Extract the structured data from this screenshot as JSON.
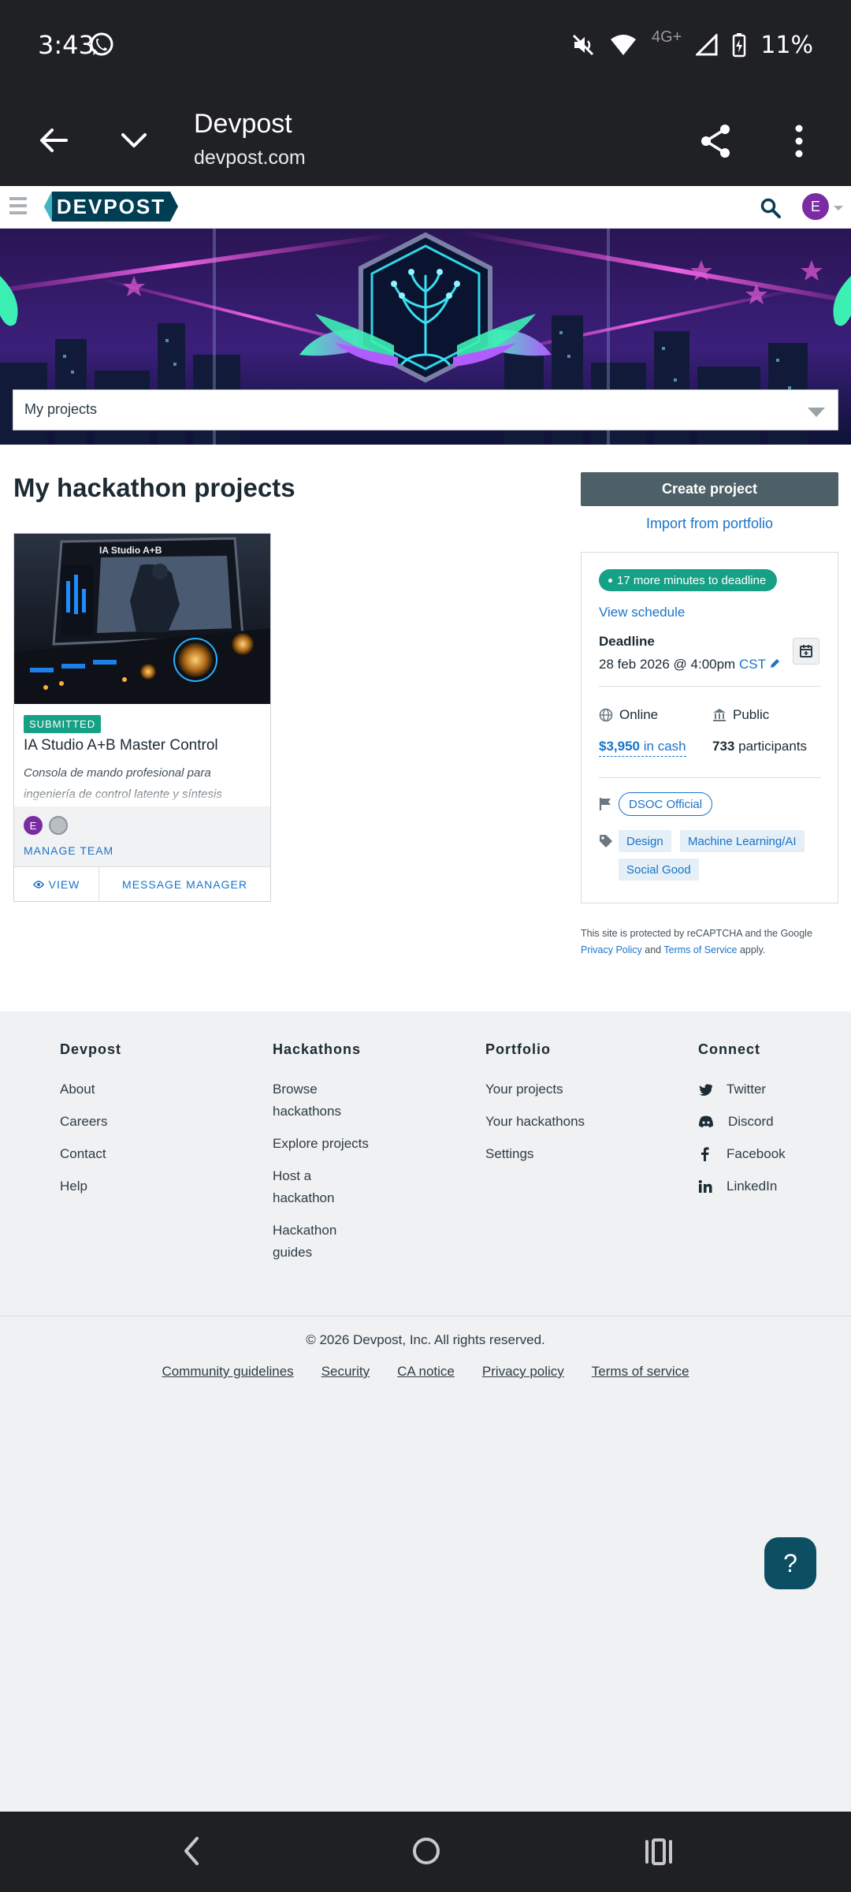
{
  "status_bar": {
    "time": "3:43",
    "network": "4G+",
    "battery": "11%"
  },
  "browser": {
    "title": "Devpost",
    "url": "devpost.com"
  },
  "header": {
    "logo_text": "DEVPOST",
    "avatar_initial": "E"
  },
  "dropdown": {
    "selected": "My projects"
  },
  "main": {
    "title": "My hackathon projects"
  },
  "project": {
    "status": "SUBMITTED",
    "image_caption": "IA Studio A+B",
    "title": "IA Studio A+B Master Control",
    "description": "Consola de mando profesional para ingeniería de control latente y síntesis",
    "member_initial": "E",
    "manage_team": "MANAGE TEAM",
    "view": "VIEW",
    "message_manager": "MESSAGE MANAGER"
  },
  "sidebar": {
    "create_button": "Create project",
    "import_link": "Import from portfolio",
    "deadline_pill": "17 more minutes to deadline",
    "view_schedule": "View schedule",
    "deadline_label": "Deadline",
    "deadline_date": "28 feb 2026 @ 4:00pm",
    "deadline_tz": "CST",
    "location": "Online",
    "visibility": "Public",
    "prize_amount": "$3,950",
    "prize_suffix": "in cash",
    "participants_count": "733",
    "participants_label": "participants",
    "host": "DSOC Official",
    "themes": [
      "Design",
      "Machine Learning/AI",
      "Social Good"
    ],
    "recaptcha_prefix": "This site is protected by reCAPTCHA and the Google",
    "privacy_policy": "Privacy Policy",
    "and": "and",
    "terms_of_service": "Terms of Service",
    "apply": "apply."
  },
  "footer": {
    "columns": [
      {
        "heading": "Devpost",
        "items": [
          "About",
          "Careers",
          "Contact",
          "Help"
        ]
      },
      {
        "heading": "Hackathons",
        "items": [
          "Browse hackathons",
          "Explore projects",
          "Host a hackathon",
          "Hackathon guides"
        ]
      },
      {
        "heading": "Portfolio",
        "items": [
          "Your projects",
          "Your hackathons",
          "Settings"
        ]
      },
      {
        "heading": "Connect",
        "items": [
          "Twitter",
          "Discord",
          "Facebook",
          "LinkedIn"
        ]
      }
    ],
    "copyright": "© 2026 Devpost, Inc. All rights reserved.",
    "links": [
      "Community guidelines",
      "Security",
      "CA notice",
      "Privacy policy",
      "Terms of service"
    ]
  },
  "help_fab": "?",
  "colors": {
    "accent": "#1a73c8",
    "success": "#16a085",
    "button": "#4d5f67",
    "logo": "#003e54",
    "avatar": "#7b2ca3",
    "fab": "#0c4f62"
  }
}
